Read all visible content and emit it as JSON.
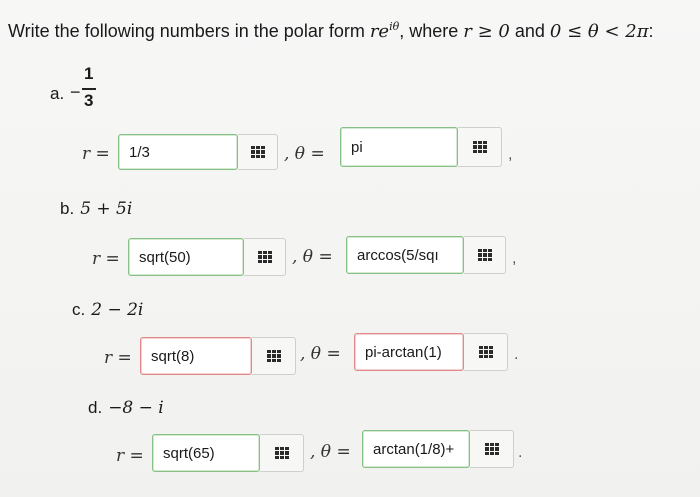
{
  "question": {
    "prefix": "Write the following numbers in the polar form ",
    "form": "re",
    "form_exp": "iθ",
    "middle": ", where ",
    "cond1": "r ≥ 0",
    "and": " and ",
    "cond2": "0 ≤ θ < 2π",
    "suffix": ":"
  },
  "parts": [
    {
      "letter": "a.",
      "expr_sign": "−",
      "expr_num": "1",
      "expr_den": "3",
      "r_label": "r =",
      "r_value": "1/3",
      "r_status": "ok",
      "theta_label": ", θ =",
      "theta_value": "pi",
      "theta_status": "ok",
      "end": ","
    },
    {
      "letter": "b.",
      "expr": "5 + 5i",
      "r_label": "r =",
      "r_value": "sqrt(50)",
      "r_status": "ok",
      "theta_label": ", θ =",
      "theta_value": "arccos(5/sqı",
      "theta_status": "ok",
      "end": ","
    },
    {
      "letter": "c.",
      "expr": "2 − 2i",
      "r_label": "r =",
      "r_value": "sqrt(8)",
      "r_status": "bad",
      "theta_label": ", θ =",
      "theta_value": "pi-arctan(1)",
      "theta_status": "bad",
      "end": "."
    },
    {
      "letter": "d.",
      "expr": "−8 − i",
      "r_label": "r =",
      "r_value": "sqrt(65)",
      "r_status": "ok",
      "theta_label": ", θ =",
      "theta_value": "arctan(1/8)+",
      "theta_status": "ok",
      "end": "."
    }
  ],
  "icons": {
    "palette": "equation-palette-icon"
  },
  "colors": {
    "correct_border": "#87c084",
    "incorrect_border": "#e3898c"
  }
}
